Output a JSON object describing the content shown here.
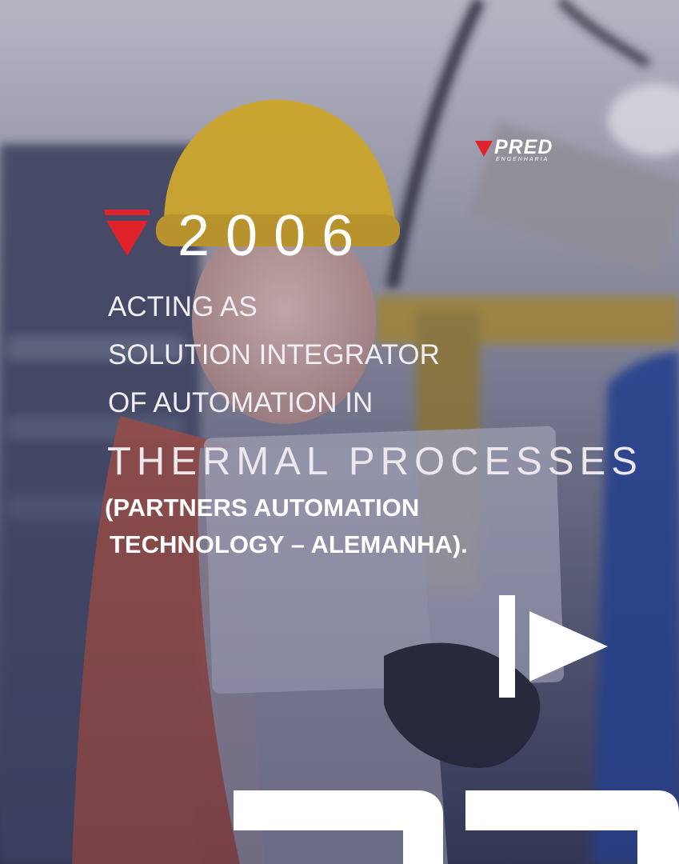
{
  "brand": {
    "name": "PRED",
    "tagline": "ENGENHARIA",
    "accent_color": "#e0232b"
  },
  "headline": {
    "year": "2006",
    "lines": [
      "ACTING AS",
      "SOLUTION INTEGRATOR",
      "OF AUTOMATION IN"
    ],
    "emphasis": "THERMAL PROCESSES",
    "detail_lines": [
      "(PARTNERS AUTOMATION",
      "TECHNOLOGY  – ALEMANHA)."
    ]
  },
  "icons": {
    "marker": "red-triangle-icon",
    "next": "play-next-icon",
    "brand_mark": "pred-brand-mark-icon"
  }
}
